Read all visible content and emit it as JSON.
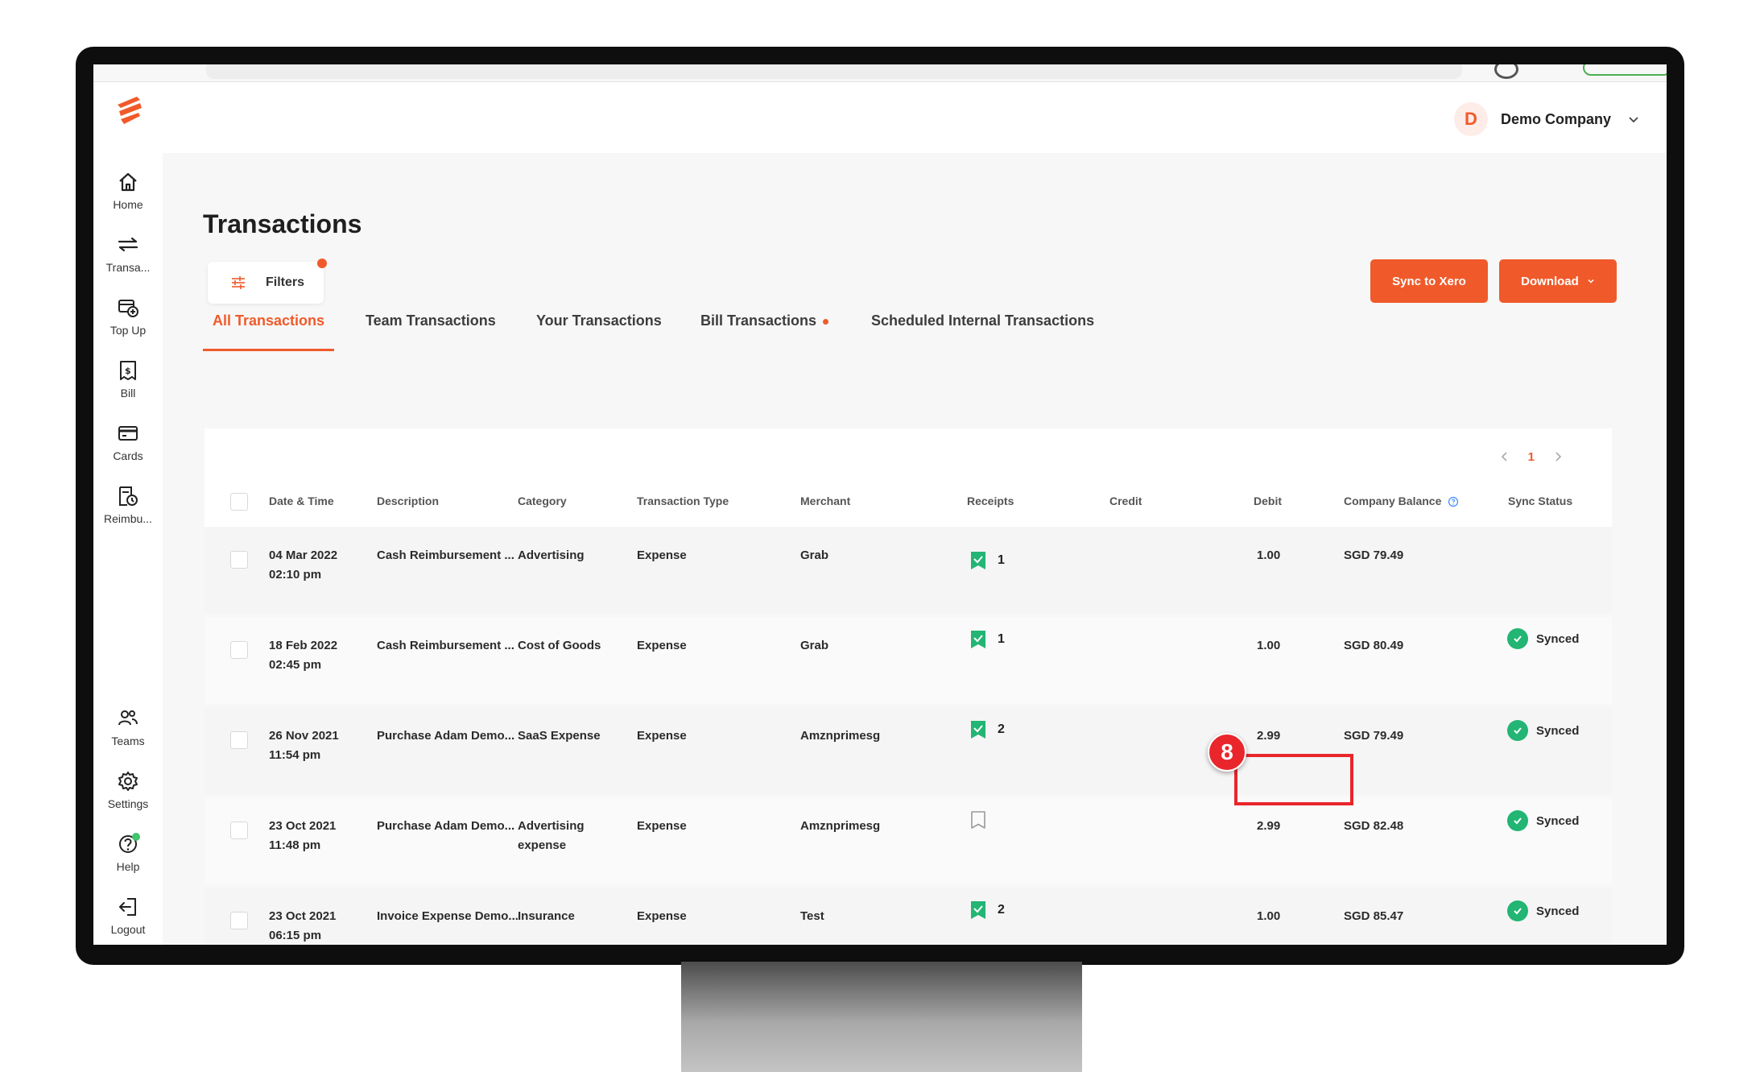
{
  "company": {
    "avatar_letter": "D",
    "name": "Demo Company"
  },
  "sidebar": {
    "items": [
      {
        "label": "Home",
        "icon": "home-icon"
      },
      {
        "label": "Transa...",
        "icon": "transfer-icon"
      },
      {
        "label": "Top Up",
        "icon": "top-up-icon"
      },
      {
        "label": "Bill",
        "icon": "bill-icon"
      },
      {
        "label": "Cards",
        "icon": "card-icon"
      },
      {
        "label": "Reimbu...",
        "icon": "reimburse-icon"
      }
    ],
    "bottom_items": [
      {
        "label": "Teams",
        "icon": "team-icon"
      },
      {
        "label": "Settings",
        "icon": "gear-icon"
      },
      {
        "label": "Help",
        "icon": "help-icon"
      },
      {
        "label": "Logout",
        "icon": "logout-icon"
      }
    ]
  },
  "page": {
    "title": "Transactions",
    "filters_label": "Filters"
  },
  "actions": {
    "sync_label": "Sync to Xero",
    "download_label": "Download"
  },
  "tabs": [
    {
      "label": "All Transactions",
      "active": true
    },
    {
      "label": "Team Transactions"
    },
    {
      "label": "Your Transactions"
    },
    {
      "label": "Bill Transactions",
      "dot": true
    },
    {
      "label": "Scheduled Internal Transactions"
    }
  ],
  "pagination": {
    "current": "1"
  },
  "table": {
    "columns": [
      "Date & Time",
      "Description",
      "Category",
      "Transaction Type",
      "Merchant",
      "Receipts",
      "Credit",
      "Debit",
      "Company Balance",
      "Sync Status"
    ],
    "rows": [
      {
        "date": "04 Mar 2022",
        "time": "02:10 pm",
        "description": "Cash Reimbursement ...",
        "category": "Advertising",
        "category2": "",
        "type": "Expense",
        "merchant": "Grab",
        "receipts": "1",
        "credit": "",
        "debit": "1.00",
        "balance": "SGD 79.49",
        "sync": ""
      },
      {
        "date": "18 Feb 2022",
        "time": "02:45 pm",
        "description": "Cash Reimbursement ...",
        "category": "Cost of Goods",
        "category2": "",
        "type": "Expense",
        "merchant": "Grab",
        "receipts": "1",
        "credit": "",
        "debit": "1.00",
        "balance": "SGD 80.49",
        "sync": "Synced"
      },
      {
        "date": "26 Nov 2021",
        "time": "11:54 pm",
        "description": "Purchase Adam Demo...",
        "category": "SaaS Expense",
        "category2": "",
        "type": "Expense",
        "merchant": "Amznprimesg",
        "receipts": "2",
        "credit": "",
        "debit": "2.99",
        "balance": "SGD 79.49",
        "sync": "Synced"
      },
      {
        "date": "23 Oct 2021",
        "time": "11:48 pm",
        "description": "Purchase Adam Demo...",
        "category": "Advertising",
        "category2": "expense",
        "type": "Expense",
        "merchant": "Amznprimesg",
        "receipts": "",
        "credit": "",
        "debit": "2.99",
        "balance": "SGD 82.48",
        "sync": "Synced"
      },
      {
        "date": "23 Oct 2021",
        "time": "06:15 pm",
        "description": "Invoice Expense Demo...",
        "category": "Insurance",
        "category2": "",
        "type": "Expense",
        "merchant": "Test",
        "receipts": "2",
        "credit": "",
        "debit": "1.00",
        "balance": "SGD 85.47",
        "sync": "Synced"
      }
    ]
  },
  "annotation": {
    "step": "8"
  },
  "colors": {
    "accent": "#f05a2a",
    "synced": "#22b573",
    "receipt": "#22b573",
    "callout": "#e8262b"
  }
}
